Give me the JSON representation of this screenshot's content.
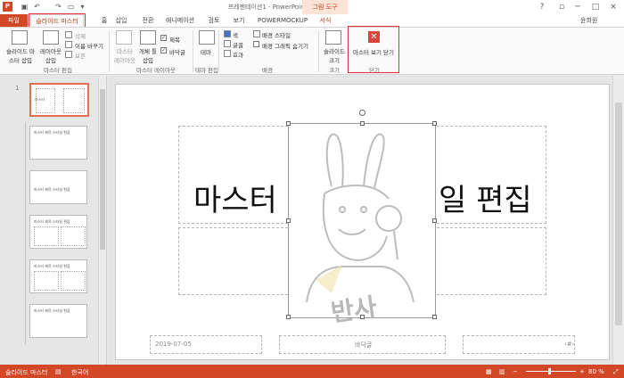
{
  "window": {
    "title": "프레젠테이션1 - PowerPoint",
    "context_tab_group": "그림 도구",
    "user": "윤희원",
    "controls": [
      "?",
      "□",
      "─",
      "□",
      "×"
    ]
  },
  "tabs": [
    {
      "label": "파일"
    },
    {
      "label": "슬라이드 마스터"
    },
    {
      "label": "홈"
    },
    {
      "label": "삽입"
    },
    {
      "label": "전환"
    },
    {
      "label": "애니메이션"
    },
    {
      "label": "검토"
    },
    {
      "label": "보기"
    },
    {
      "label": "POWERMOCKUP"
    },
    {
      "label": "서식"
    }
  ],
  "ribbon": {
    "edit_master": {
      "insert_master": "슬라이드 마\n스터 삽입",
      "insert_layout": "레이아웃\n삽입",
      "delete": "삭제",
      "rename": "이름 바꾸기",
      "preserve": "보존",
      "group_label": "마스터 편집"
    },
    "master_layout": {
      "master_layout_btn": "마스터\n레이아웃",
      "insert_placeholder": "개체 틀\n삽입",
      "title_check": "제목",
      "footer_check": "바닥글",
      "group_label": "마스터 레이아웃"
    },
    "edit_theme": {
      "themes": "테마",
      "group_label": "테마 편집"
    },
    "background": {
      "colors": "색",
      "fonts": "글꼴",
      "effects": "효과",
      "bg_styles": "배경 스타일",
      "hide_bg": "배경 그래픽 숨기기",
      "group_label": "배경"
    },
    "size": {
      "slide_size": "슬라이드\n크기",
      "group_label": "크기"
    },
    "close": {
      "close_master": "마스터 보기 닫기",
      "group_label": "닫기"
    }
  },
  "thumbnails": [
    {
      "num": "1",
      "title": "마스터"
    },
    {
      "num": "",
      "title": "마스터 제목 스타일 편집"
    },
    {
      "num": "",
      "title": "마스터 제목 스타일 편집"
    },
    {
      "num": "",
      "title": "마스터 제목 스타일 편집"
    },
    {
      "num": "",
      "title": "마스터 제목 스타일 편집"
    },
    {
      "num": "",
      "title": "마스터 제목 스타일 편집"
    }
  ],
  "slide": {
    "title_left": "마스터",
    "title_right": "일 편집",
    "watermark": "반사",
    "date": "2019-07-05",
    "footer": "바닥글",
    "page_mark": "‹#›"
  },
  "status": {
    "view": "슬라이드 마스터",
    "language": "한국어",
    "zoom": "80 %"
  }
}
